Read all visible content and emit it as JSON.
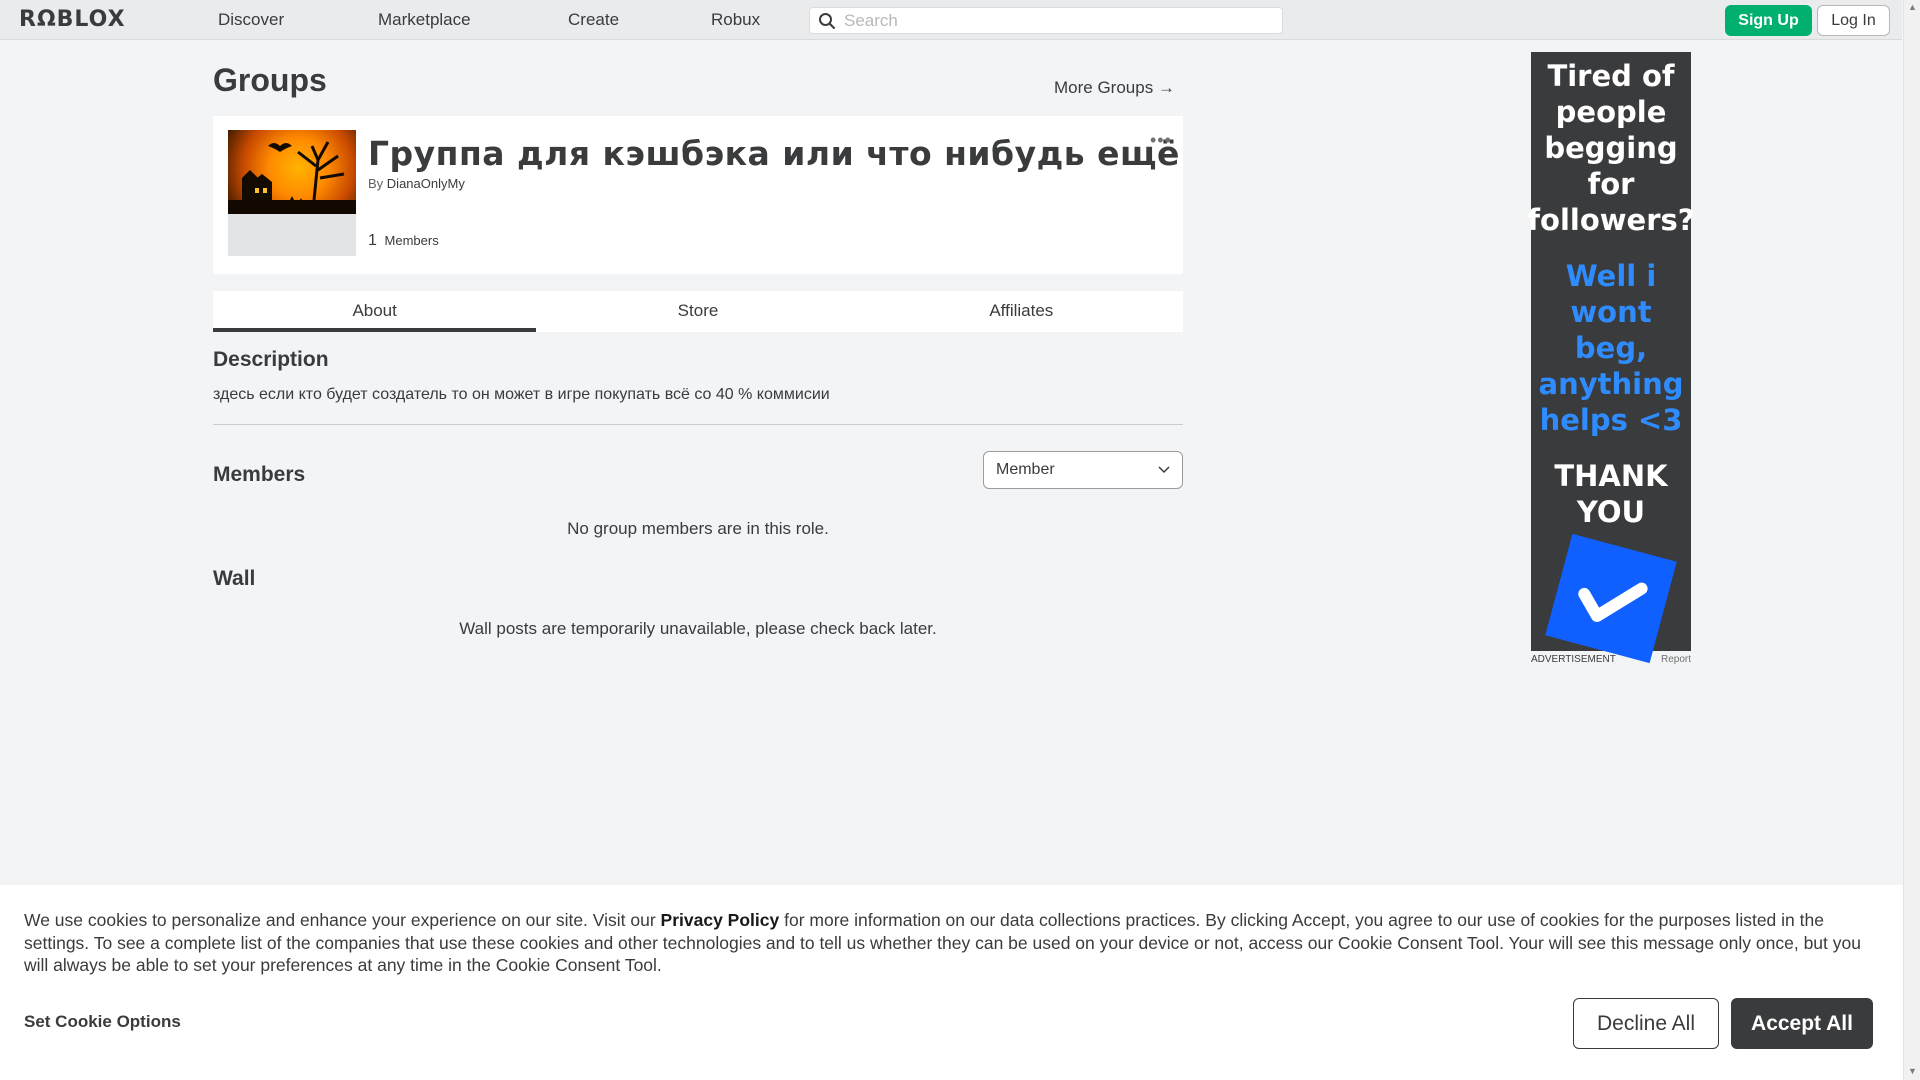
{
  "nav": {
    "logo": "RΩBLOX",
    "links": [
      "Discover",
      "Marketplace",
      "Create",
      "Robux"
    ],
    "search_placeholder": "Search",
    "signup_label": "Sign Up",
    "login_label": "Log In"
  },
  "page": {
    "title": "Groups",
    "more_groups": "More Groups →"
  },
  "group": {
    "name": "Группа для кэшбэка или что нибудь ещё",
    "by_label": "By",
    "owner": "DianaOnlyMy",
    "member_count": "1",
    "members_label": "Members",
    "more_icon": "•••"
  },
  "tabs": [
    "About",
    "Store",
    "Affiliates"
  ],
  "description": {
    "heading": "Description",
    "text": "здесь если кто будет создатель то он может в игре покупать всё со 40 % коммисии"
  },
  "members": {
    "heading": "Members",
    "role_selected": "Member",
    "empty_message": "No group members are in this role."
  },
  "wall": {
    "heading": "Wall",
    "message": "Wall posts are temporarily unavailable, please check back later."
  },
  "ad": {
    "line1": "Tired of people begging for followers?",
    "line2": "Well i wont beg, anything helps <3",
    "line3": "THANK YOU",
    "label": "ADVERTISEMENT",
    "report": "Report"
  },
  "cookie": {
    "text_before": "We use cookies to personalize and enhance your experience on our site. Visit our ",
    "privacy_link": "Privacy Policy",
    "text_after": " for more information on our data collections practices. By clicking Accept, you agree to our use of cookies for the purposes listed in the settings. To see a complete list of the companies that use these cookies and other technologies and to tell us whether they can be used on your device or not, access our Cookie Consent Tool. Your will see this message only once, but you will always be able to set your preferences at any time in the Cookie Consent Tool.",
    "options_label": "Set Cookie Options",
    "decline_label": "Decline All",
    "accept_label": "Accept All"
  },
  "colors": {
    "signup_green": "#00b06f",
    "ad_blue": "#2f8cff",
    "dark": "#393b3d"
  }
}
